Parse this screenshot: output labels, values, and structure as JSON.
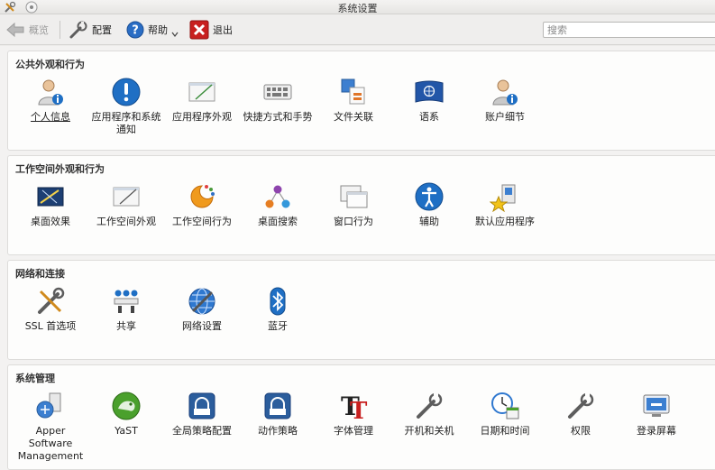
{
  "window": {
    "title": "系统设置"
  },
  "toolbar": {
    "overview_label": "概览",
    "configure_label": "配置",
    "help_label": "帮助",
    "quit_label": "退出"
  },
  "search": {
    "placeholder": "搜索"
  },
  "groups": [
    {
      "title": "公共外观和行为",
      "items": [
        {
          "label": "个人信息",
          "icon": "user-info-icon"
        },
        {
          "label": "应用程序和系统通知",
          "icon": "notification-icon"
        },
        {
          "label": "应用程序外观",
          "icon": "app-appearance-icon"
        },
        {
          "label": "快捷方式和手势",
          "icon": "keyboard-shortcuts-icon"
        },
        {
          "label": "文件关联",
          "icon": "file-associations-icon"
        },
        {
          "label": "语系",
          "icon": "locale-flag-icon"
        },
        {
          "label": "账户细节",
          "icon": "account-details-icon"
        }
      ]
    },
    {
      "title": "工作空间外观和行为",
      "items": [
        {
          "label": "桌面效果",
          "icon": "desktop-effects-icon"
        },
        {
          "label": "工作空间外观",
          "icon": "workspace-appearance-icon"
        },
        {
          "label": "工作空间行为",
          "icon": "workspace-behavior-icon"
        },
        {
          "label": "桌面搜索",
          "icon": "desktop-search-icon"
        },
        {
          "label": "窗口行为",
          "icon": "window-behavior-icon"
        },
        {
          "label": "辅助",
          "icon": "accessibility-icon"
        },
        {
          "label": "默认应用程序",
          "icon": "default-apps-icon"
        }
      ]
    },
    {
      "title": "网络和连接",
      "items": [
        {
          "label": "SSL 首选项",
          "icon": "ssl-tools-icon"
        },
        {
          "label": "共享",
          "icon": "sharing-icon"
        },
        {
          "label": "网络设置",
          "icon": "network-globe-icon"
        },
        {
          "label": "蓝牙",
          "icon": "bluetooth-icon"
        }
      ]
    },
    {
      "title": "系统管理",
      "items": [
        {
          "label": "Apper Software Management",
          "icon": "apper-package-icon"
        },
        {
          "label": "YaST",
          "icon": "yast-chameleon-icon"
        },
        {
          "label": "全局策略配置",
          "icon": "global-policy-icon"
        },
        {
          "label": "动作策略",
          "icon": "action-policy-icon"
        },
        {
          "label": "字体管理",
          "icon": "font-management-icon"
        },
        {
          "label": "开机和关机",
          "icon": "startup-shutdown-icon"
        },
        {
          "label": "日期和时间",
          "icon": "date-time-icon"
        },
        {
          "label": "权限",
          "icon": "permissions-icon"
        },
        {
          "label": "登录屏幕",
          "icon": "login-screen-icon"
        }
      ]
    }
  ],
  "colors": {
    "accent_blue": "#1f6fc4",
    "quit_red": "#c8201f"
  }
}
